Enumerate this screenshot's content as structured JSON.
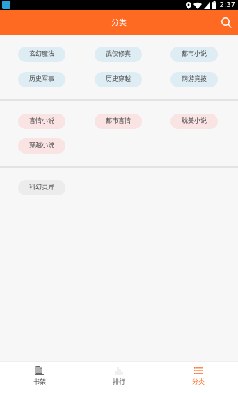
{
  "status_bar": {
    "time": "2:37"
  },
  "header": {
    "title": "分类"
  },
  "categories": {
    "section1": [
      "玄幻魔法",
      "武侠修真",
      "都市小说",
      "历史军事",
      "历史穿越",
      "网游竞技"
    ],
    "section2": [
      "言情小说",
      "都市言情",
      "耽美小说",
      "穿越小说"
    ],
    "section3": [
      "科幻灵异"
    ]
  },
  "bottom_nav": {
    "items": [
      {
        "label": "书架",
        "icon": "bookshelf-icon"
      },
      {
        "label": "排行",
        "icon": "ranking-icon"
      },
      {
        "label": "分类",
        "icon": "category-list-icon",
        "active": true
      }
    ]
  },
  "colors": {
    "accent": "#ff6a22",
    "chip_blue": "#deedf4",
    "chip_pink": "#f9e3e3",
    "chip_gray": "#ececec"
  }
}
